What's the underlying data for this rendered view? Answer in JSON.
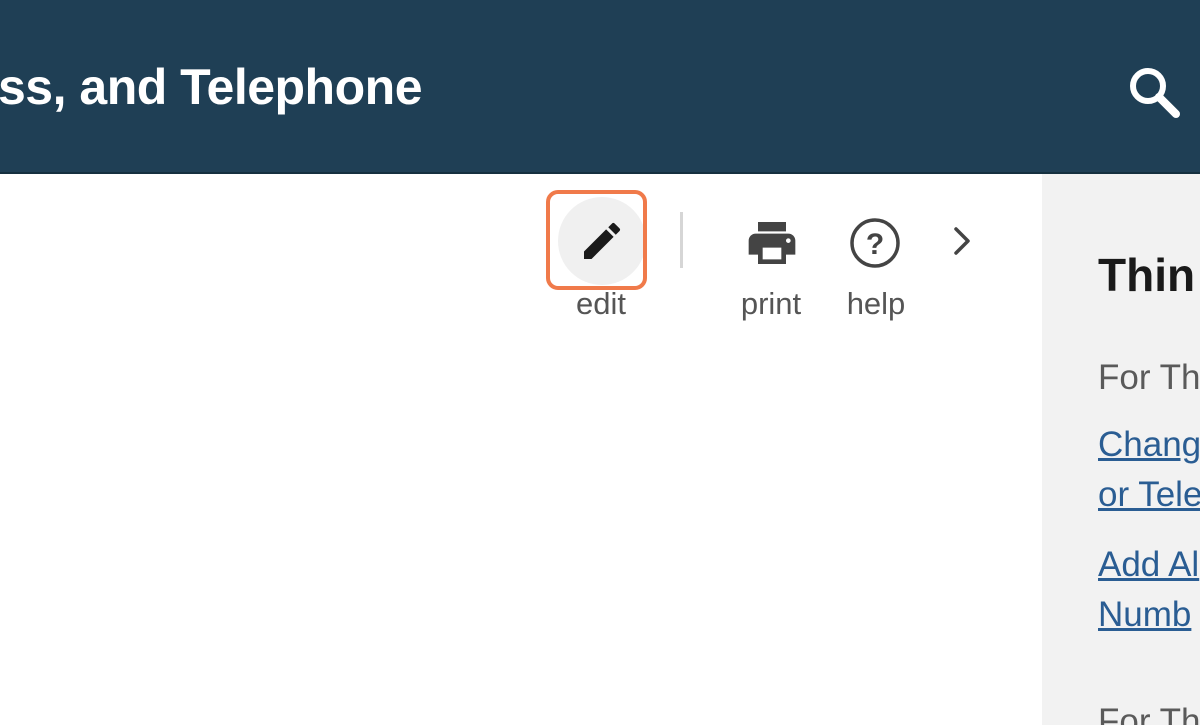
{
  "header": {
    "title": "ss, and Telephone",
    "search_icon": "search-icon",
    "background_color": "#1f3f55"
  },
  "toolbar": {
    "edit": {
      "label": "edit",
      "icon": "pencil-icon",
      "highlight_color": "#f07a4a"
    },
    "print": {
      "label": "print",
      "icon": "printer-icon"
    },
    "help": {
      "label": "help",
      "icon": "help-circle-icon"
    },
    "more": {
      "icon": "chevron-right-icon"
    }
  },
  "side_panel": {
    "title": "Thin",
    "subheading": "For Th",
    "links": [
      {
        "line1": "Chang",
        "line2": "or Tele"
      },
      {
        "line1": "Add Al",
        "line2": "Numb"
      }
    ],
    "subheading2": "For Th",
    "link_color": "#2a5d93"
  }
}
